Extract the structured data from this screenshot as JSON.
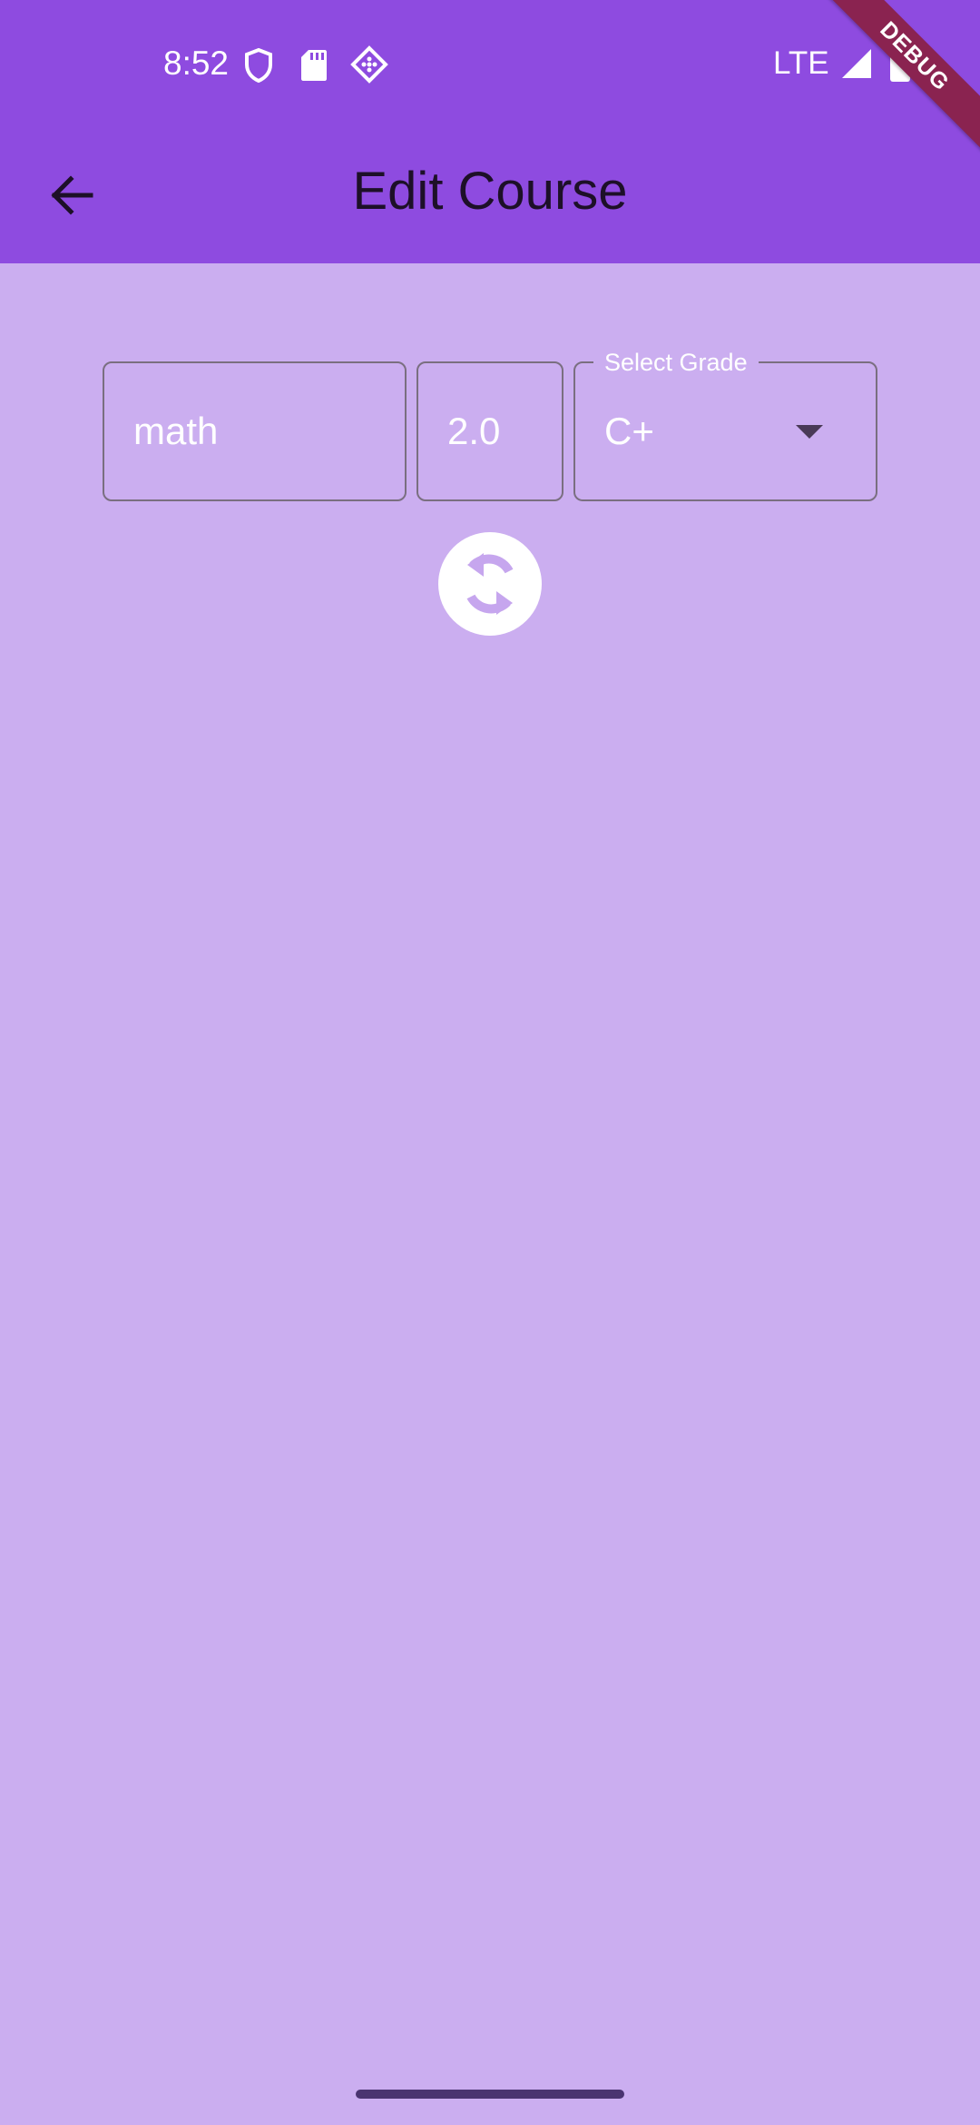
{
  "status_bar": {
    "time": "8:52",
    "network": "LTE",
    "left_icons": [
      "shield-icon",
      "sd-card-icon",
      "app-diamond-icon"
    ],
    "right_icons": [
      "signal-icon",
      "battery-icon"
    ]
  },
  "debug_banner": "DEBUG",
  "app_bar": {
    "title": "Edit Course",
    "back_icon": "arrow-left-icon"
  },
  "form": {
    "course_name": {
      "value": "math"
    },
    "credits": {
      "value": "2.0"
    },
    "grade": {
      "label": "Select Grade",
      "value": "C+",
      "icon": "dropdown-arrow-icon"
    }
  },
  "actions": {
    "refresh_icon": "refresh-icon"
  },
  "colors": {
    "app_bar": "#8e4be0",
    "background": "#cbaef0",
    "debug_banner": "#8a2350"
  }
}
